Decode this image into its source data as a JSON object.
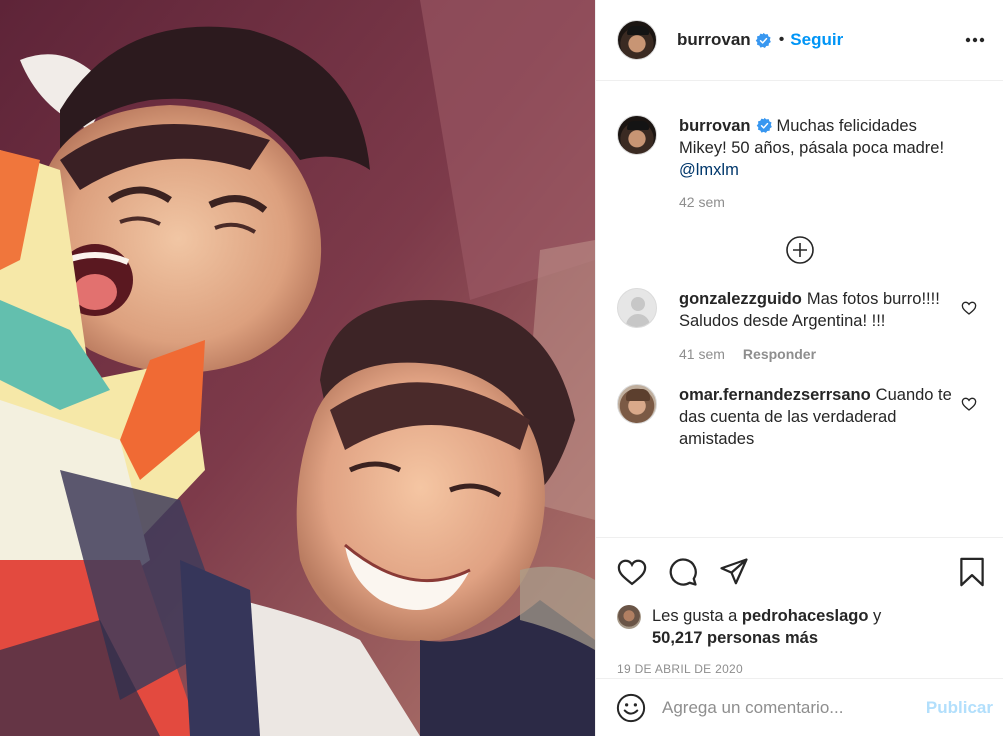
{
  "post": {
    "author": {
      "username": "burrovan",
      "verified": true,
      "follow_label": "Seguir",
      "separator": "•"
    },
    "caption": {
      "username": "burrovan",
      "text": "Muchas felicidades Mikey! 50 años, pásala poca madre!",
      "mention": "@lmxlm",
      "time": "42 sem"
    },
    "comments": [
      {
        "username": "gonzalezzguido",
        "text": "Mas fotos burro!!!! Saludos desde Argentina! !!!",
        "time": "41 sem",
        "reply_label": "Responder"
      },
      {
        "username": "omar.fernandezserrsano",
        "text": "Cuando te das cuenta de las verdaderad amistades"
      }
    ],
    "likes": {
      "prefix": "Les gusta a",
      "user": "pedrohaceslago",
      "conjunction": "y",
      "count": "50,217 personas más"
    },
    "date": "19 de abril de 2020",
    "composer": {
      "placeholder": "Agrega un comentario...",
      "publish_label": "Publicar"
    },
    "icons": {
      "more": "more-options-icon",
      "load_more": "plus-circle-icon",
      "like": "heart-icon",
      "comment": "comment-bubble-icon",
      "share": "paper-plane-icon",
      "save": "bookmark-icon",
      "emoji": "emoji-icon"
    },
    "colors": {
      "link_blue": "#0095f6",
      "publish_disabled": "#b2dffc",
      "muted": "#8e8e8e",
      "mention": "#00376b"
    }
  }
}
